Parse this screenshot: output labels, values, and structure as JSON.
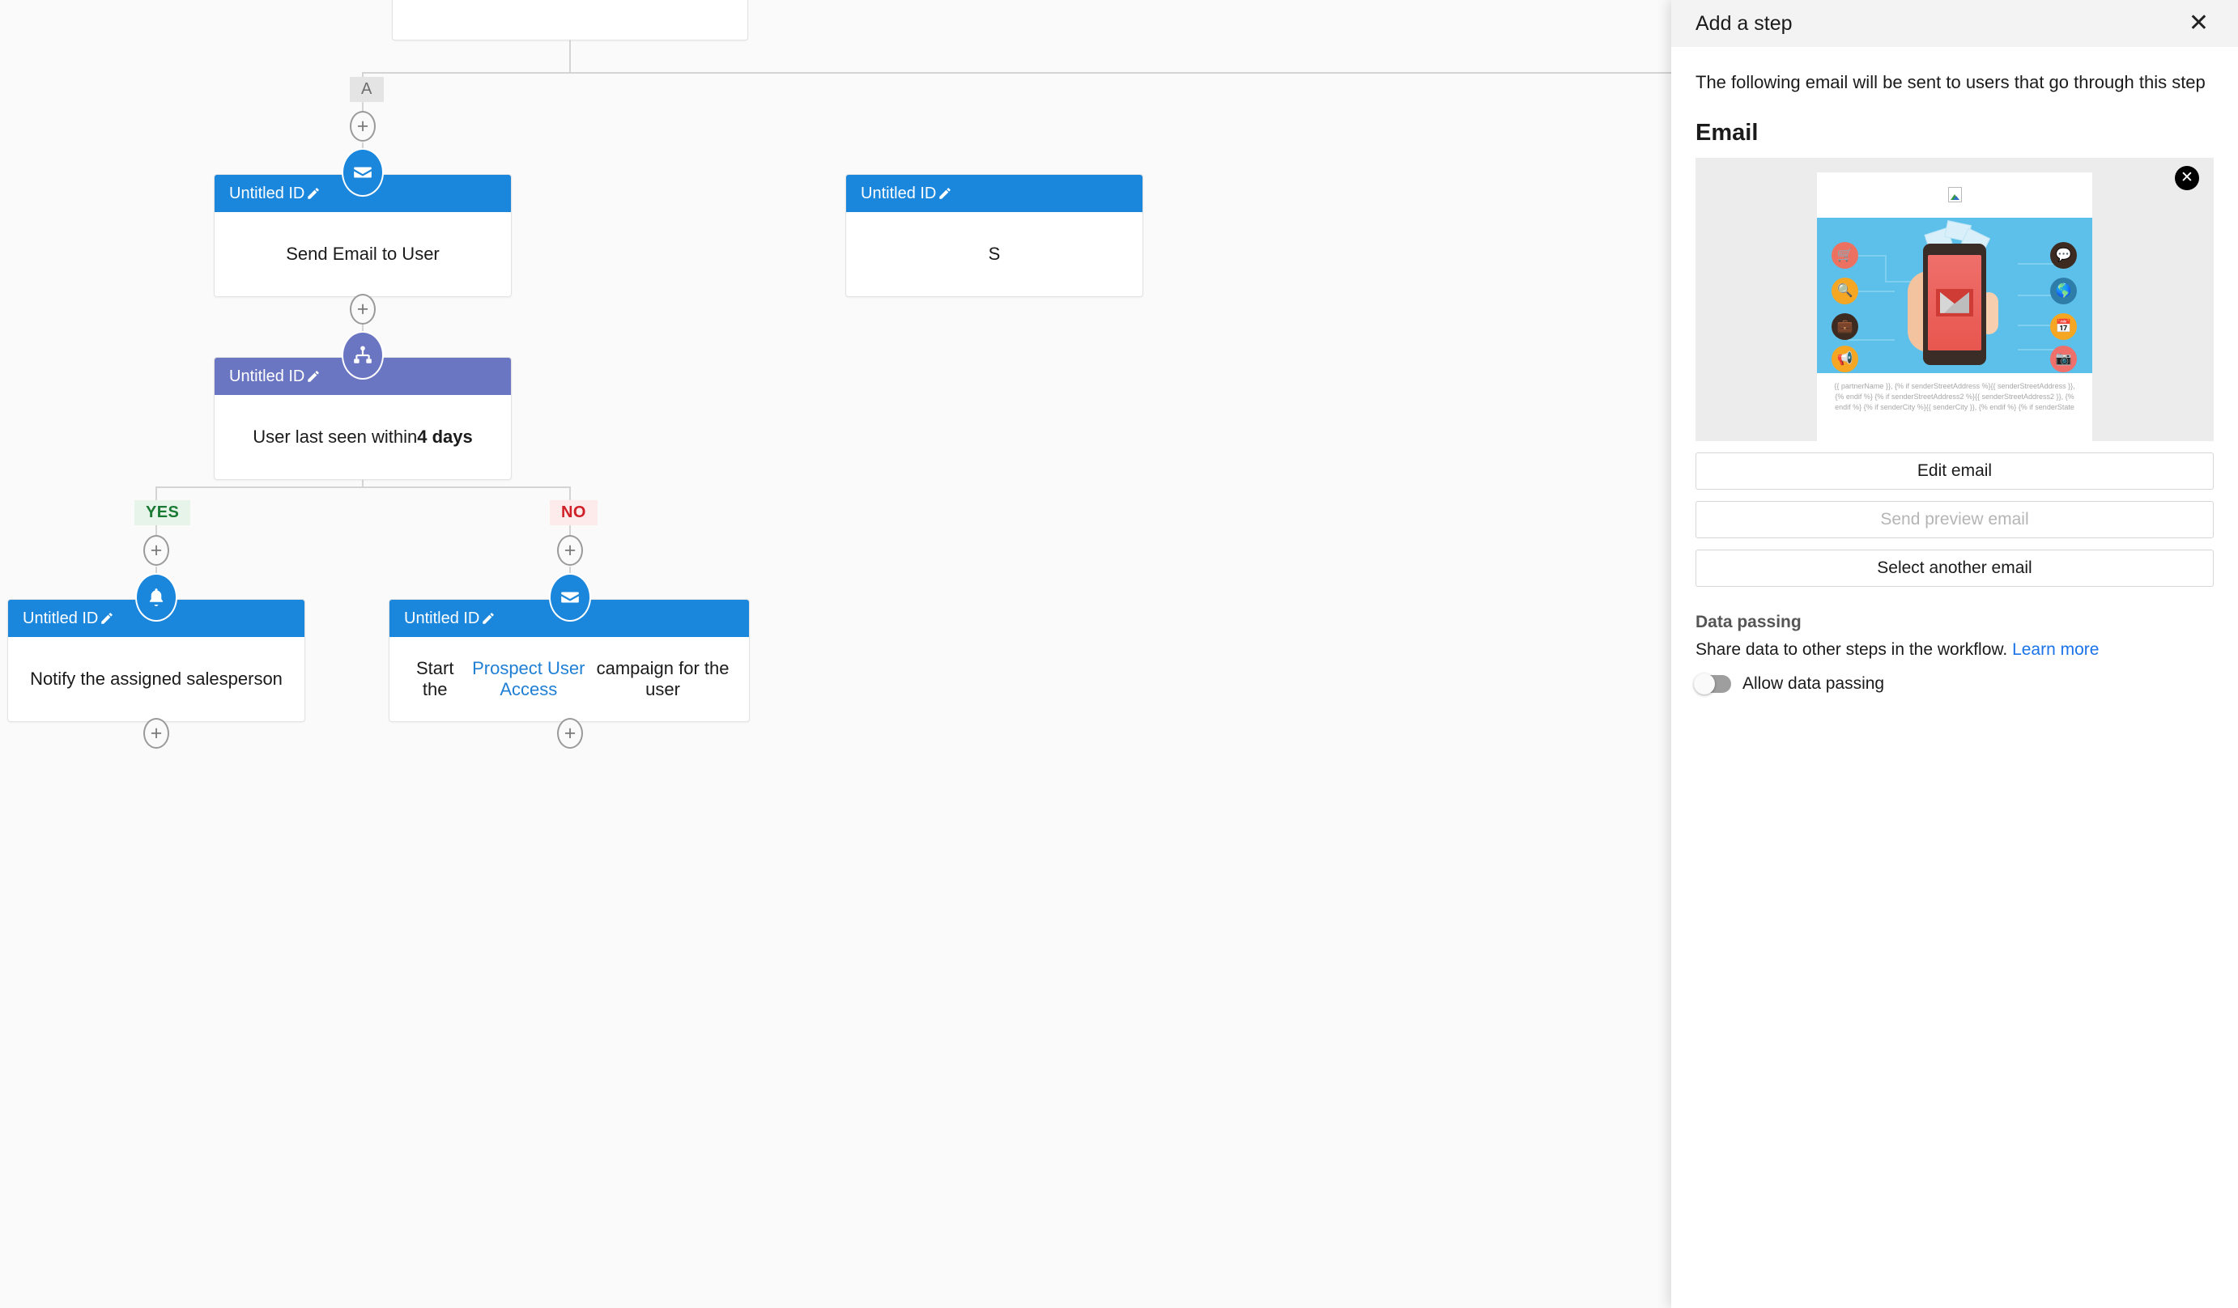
{
  "canvas": {
    "branch_tag_a": "A",
    "branch_yes": "YES",
    "branch_no": "NO",
    "add_step_glyph": "+",
    "nodes": [
      {
        "id": "send-email-to-user",
        "header": "Untitled ID",
        "body": "Send Email to User",
        "icon": "envelope-icon",
        "color": "#1a86dc"
      },
      {
        "id": "condition-last-seen",
        "header": "Untitled ID",
        "body_prefix": "User last seen within ",
        "body_strong": "4 days",
        "icon": "branch-icon",
        "color": "#6b76c2"
      },
      {
        "id": "notify-salesperson",
        "header": "Untitled ID",
        "body": "Notify the assigned salesperson",
        "icon": "bell-icon",
        "color": "#1a86dc"
      },
      {
        "id": "start-campaign",
        "header": "Untitled ID",
        "body_prefix": "Start the ",
        "body_link": "Prospect User Access",
        "body_suffix": " campaign for the user",
        "icon": "envelope-icon",
        "color": "#1a86dc"
      },
      {
        "id": "offscreen-right-node",
        "header": "Untitled ID",
        "body": "S",
        "icon": "envelope-icon",
        "color": "#1a86dc"
      }
    ]
  },
  "panel": {
    "title": "Add a step",
    "close_glyph": "✕",
    "description": "The following email will be sent to users that go through this step",
    "section_email": "Email",
    "email_preview": {
      "close_glyph": "✕",
      "footer_text": "{{ partnerName }}, {% if senderStreetAddress %}{{ senderStreetAddress }}, {% endif %} {% if senderStreetAddress2 %}{{ senderStreetAddress2 }}, {% endif %} {% if senderCity %}{{ senderCity }}, {% endif %} {% if senderState",
      "hero_icons": [
        {
          "name": "cart-icon",
          "glyph": "🛒",
          "color": "#ed7161"
        },
        {
          "name": "search-icon",
          "glyph": "🔍",
          "color": "#f5a623"
        },
        {
          "name": "briefcase-icon",
          "glyph": "💼",
          "color": "#3d2b22"
        },
        {
          "name": "megaphone-icon",
          "glyph": "📢",
          "color": "#f5a623"
        },
        {
          "name": "chat-icon",
          "glyph": "💬",
          "color": "#3d2b22"
        },
        {
          "name": "globe-icon",
          "glyph": "🌐",
          "color": "#2e7da8"
        },
        {
          "name": "calendar-icon",
          "glyph": "📅",
          "color": "#f5a623"
        },
        {
          "name": "image-icon",
          "glyph": "🖼",
          "color": "#ef6f6b"
        }
      ]
    },
    "buttons": {
      "edit_email": "Edit email",
      "send_preview_email": "Send preview email",
      "select_another_email": "Select another email"
    },
    "data_passing": {
      "heading": "Data passing",
      "description": "Share data to other steps in the workflow.",
      "learn_more": "Learn more",
      "toggle_label": "Allow data passing",
      "toggle_on": false
    }
  },
  "colors": {
    "accent_blue": "#1a86dc",
    "accent_purple": "#6b76c2",
    "link_blue": "#1a73e8",
    "yes_green": "#1a7a33",
    "no_red": "#cf2027"
  }
}
